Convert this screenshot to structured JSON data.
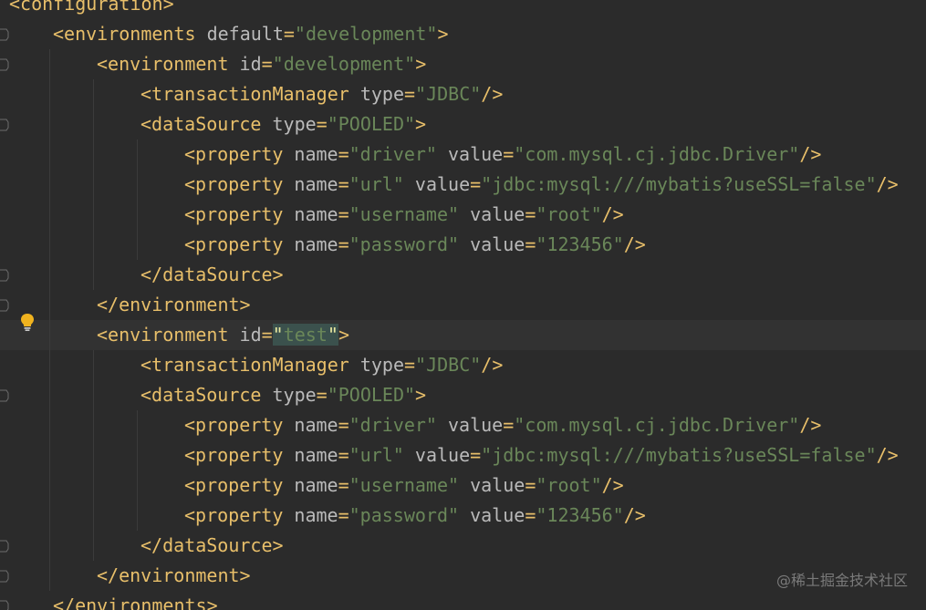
{
  "editor": {
    "language": "xml",
    "current_line_index": 11,
    "watermark": "@稀土掘金技术社区",
    "colors": {
      "background": "#2b2b2b",
      "current_line": "#323232",
      "tag": "#e8bf6a",
      "attribute": "#bababa",
      "value": "#6a8759",
      "text": "#a9b7c6",
      "highlight": "#3b514d",
      "bulb": "#f0b31f"
    },
    "lines": [
      {
        "text": "<configuration>",
        "tokens": [
          {
            "t": "tag",
            "v": "<configuration>"
          }
        ]
      },
      {
        "text": "<environments default=\"development\">",
        "tokens": [
          {
            "t": "tag",
            "v": "<environments"
          },
          {
            "t": "attr",
            "v": " default"
          },
          {
            "t": "punct",
            "v": "="
          },
          {
            "t": "val",
            "v": "\"development\""
          },
          {
            "t": "tag",
            "v": ">"
          }
        ]
      },
      {
        "text": "<environment id=\"development\">",
        "tokens": [
          {
            "t": "tag",
            "v": "<environment"
          },
          {
            "t": "attr",
            "v": " id"
          },
          {
            "t": "punct",
            "v": "="
          },
          {
            "t": "val",
            "v": "\"development\""
          },
          {
            "t": "tag",
            "v": ">"
          }
        ]
      },
      {
        "text": "<transactionManager type=\"JDBC\"/>",
        "tokens": [
          {
            "t": "tag",
            "v": "<transactionManager"
          },
          {
            "t": "attr",
            "v": " type"
          },
          {
            "t": "punct",
            "v": "="
          },
          {
            "t": "val",
            "v": "\"JDBC\""
          },
          {
            "t": "tag",
            "v": "/>"
          }
        ]
      },
      {
        "text": "<dataSource type=\"POOLED\">",
        "tokens": [
          {
            "t": "tag",
            "v": "<dataSource"
          },
          {
            "t": "attr",
            "v": " type"
          },
          {
            "t": "punct",
            "v": "="
          },
          {
            "t": "val",
            "v": "\"POOLED\""
          },
          {
            "t": "tag",
            "v": ">"
          }
        ]
      },
      {
        "text": "<property name=\"driver\" value=\"com.mysql.cj.jdbc.Driver\"/>",
        "tokens": [
          {
            "t": "tag",
            "v": "<property"
          },
          {
            "t": "attr",
            "v": " name"
          },
          {
            "t": "punct",
            "v": "="
          },
          {
            "t": "val",
            "v": "\"driver\""
          },
          {
            "t": "attr",
            "v": " value"
          },
          {
            "t": "punct",
            "v": "="
          },
          {
            "t": "val",
            "v": "\"com.mysql.cj.jdbc.Driver\""
          },
          {
            "t": "tag",
            "v": "/>"
          }
        ]
      },
      {
        "text": "<property name=\"url\" value=\"jdbc:mysql:///mybatis?useSSL=false\"/>",
        "tokens": [
          {
            "t": "tag",
            "v": "<property"
          },
          {
            "t": "attr",
            "v": " name"
          },
          {
            "t": "punct",
            "v": "="
          },
          {
            "t": "val",
            "v": "\"url\""
          },
          {
            "t": "attr",
            "v": " value"
          },
          {
            "t": "punct",
            "v": "="
          },
          {
            "t": "val",
            "v": "\"jdbc:mysql:///mybatis?useSSL=false\""
          },
          {
            "t": "tag",
            "v": "/>"
          }
        ]
      },
      {
        "text": "<property name=\"username\" value=\"root\"/>",
        "tokens": [
          {
            "t": "tag",
            "v": "<property"
          },
          {
            "t": "attr",
            "v": " name"
          },
          {
            "t": "punct",
            "v": "="
          },
          {
            "t": "val",
            "v": "\"username\""
          },
          {
            "t": "attr",
            "v": " value"
          },
          {
            "t": "punct",
            "v": "="
          },
          {
            "t": "val",
            "v": "\"root\""
          },
          {
            "t": "tag",
            "v": "/>"
          }
        ]
      },
      {
        "text": "<property name=\"password\" value=\"123456\"/>",
        "tokens": [
          {
            "t": "tag",
            "v": "<property"
          },
          {
            "t": "attr",
            "v": " name"
          },
          {
            "t": "punct",
            "v": "="
          },
          {
            "t": "val",
            "v": "\"password\""
          },
          {
            "t": "attr",
            "v": " value"
          },
          {
            "t": "punct",
            "v": "="
          },
          {
            "t": "val",
            "v": "\"123456\""
          },
          {
            "t": "tag",
            "v": "/>"
          }
        ]
      },
      {
        "text": "</dataSource>",
        "tokens": [
          {
            "t": "tag",
            "v": "</dataSource>"
          }
        ]
      },
      {
        "text": "</environment>",
        "tokens": [
          {
            "t": "tag",
            "v": "</environment>"
          }
        ]
      },
      {
        "text": "<environment id=\"test\">",
        "tokens": [
          {
            "t": "tag",
            "v": "<environment"
          },
          {
            "t": "attr",
            "v": " id"
          },
          {
            "t": "punct",
            "v": "="
          },
          {
            "t": "qhl",
            "v": "\""
          },
          {
            "t": "hl",
            "v": "test"
          },
          {
            "t": "qhl",
            "v": "\""
          },
          {
            "t": "tag",
            "v": ">"
          }
        ]
      },
      {
        "text": "<transactionManager type=\"JDBC\"/>",
        "tokens": [
          {
            "t": "tag",
            "v": "<transactionManager"
          },
          {
            "t": "attr",
            "v": " type"
          },
          {
            "t": "punct",
            "v": "="
          },
          {
            "t": "val",
            "v": "\"JDBC\""
          },
          {
            "t": "tag",
            "v": "/>"
          }
        ]
      },
      {
        "text": "<dataSource type=\"POOLED\">",
        "tokens": [
          {
            "t": "tag",
            "v": "<dataSource"
          },
          {
            "t": "attr",
            "v": " type"
          },
          {
            "t": "punct",
            "v": "="
          },
          {
            "t": "val",
            "v": "\"POOLED\""
          },
          {
            "t": "tag",
            "v": ">"
          }
        ]
      },
      {
        "text": "<property name=\"driver\" value=\"com.mysql.cj.jdbc.Driver\"/>",
        "tokens": [
          {
            "t": "tag",
            "v": "<property"
          },
          {
            "t": "attr",
            "v": " name"
          },
          {
            "t": "punct",
            "v": "="
          },
          {
            "t": "val",
            "v": "\"driver\""
          },
          {
            "t": "attr",
            "v": " value"
          },
          {
            "t": "punct",
            "v": "="
          },
          {
            "t": "val",
            "v": "\"com.mysql.cj.jdbc.Driver\""
          },
          {
            "t": "tag",
            "v": "/>"
          }
        ]
      },
      {
        "text": "<property name=\"url\" value=\"jdbc:mysql:///mybatis?useSSL=false\"/>",
        "tokens": [
          {
            "t": "tag",
            "v": "<property"
          },
          {
            "t": "attr",
            "v": " name"
          },
          {
            "t": "punct",
            "v": "="
          },
          {
            "t": "val",
            "v": "\"url\""
          },
          {
            "t": "attr",
            "v": " value"
          },
          {
            "t": "punct",
            "v": "="
          },
          {
            "t": "val",
            "v": "\"jdbc:mysql:///mybatis?useSSL=false\""
          },
          {
            "t": "tag",
            "v": "/>"
          }
        ]
      },
      {
        "text": "<property name=\"username\" value=\"root\"/>",
        "tokens": [
          {
            "t": "tag",
            "v": "<property"
          },
          {
            "t": "attr",
            "v": " name"
          },
          {
            "t": "punct",
            "v": "="
          },
          {
            "t": "val",
            "v": "\"username\""
          },
          {
            "t": "attr",
            "v": " value"
          },
          {
            "t": "punct",
            "v": "="
          },
          {
            "t": "val",
            "v": "\"root\""
          },
          {
            "t": "tag",
            "v": "/>"
          }
        ]
      },
      {
        "text": "<property name=\"password\" value=\"123456\"/>",
        "tokens": [
          {
            "t": "tag",
            "v": "<property"
          },
          {
            "t": "attr",
            "v": " name"
          },
          {
            "t": "punct",
            "v": "="
          },
          {
            "t": "val",
            "v": "\"password\""
          },
          {
            "t": "attr",
            "v": " value"
          },
          {
            "t": "punct",
            "v": "="
          },
          {
            "t": "val",
            "v": "\"123456\""
          },
          {
            "t": "tag",
            "v": "/>"
          }
        ]
      },
      {
        "text": "</dataSource>",
        "tokens": [
          {
            "t": "tag",
            "v": "</dataSource>"
          }
        ]
      },
      {
        "text": "</environment>",
        "tokens": [
          {
            "t": "tag",
            "v": "</environment>"
          }
        ]
      },
      {
        "text": "</environments>",
        "tokens": [
          {
            "t": "tag",
            "v": "</environments>"
          }
        ]
      }
    ]
  }
}
